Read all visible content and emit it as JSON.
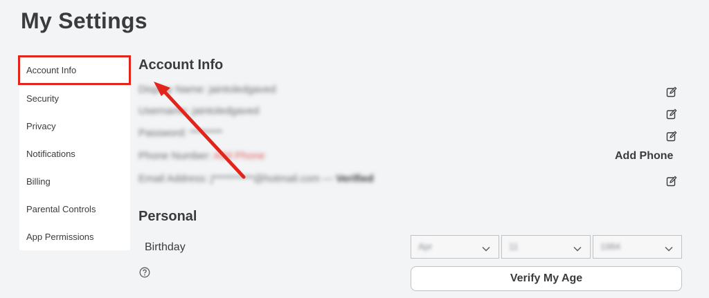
{
  "page_title": "My Settings",
  "sidebar": {
    "items": [
      {
        "label": "Account Info",
        "active": true
      },
      {
        "label": "Security"
      },
      {
        "label": "Privacy"
      },
      {
        "label": "Notifications"
      },
      {
        "label": "Billing"
      },
      {
        "label": "Parental Controls"
      },
      {
        "label": "App Permissions"
      }
    ]
  },
  "account_info": {
    "header": "Account Info",
    "display_name_row": "Display Name: ",
    "username_row": "Username: ",
    "password_row": "Password: ********",
    "phone_row_label": "Phone Number: ",
    "phone_row_value": "Add Phone",
    "email_row_label": "Email Address: ",
    "email_row_value": "@hotmail.com",
    "email_verified": "Verified",
    "add_phone_label": "Add Phone"
  },
  "personal": {
    "header": "Personal",
    "birthday_label": "Birthday",
    "month_value": "Apr",
    "day_value": "11",
    "year_value": "1984",
    "verify_button_label": "Verify My Age"
  },
  "colors": {
    "highlight_red": "#e2241b",
    "background": "#f2f4f5",
    "text": "#393b3d"
  }
}
